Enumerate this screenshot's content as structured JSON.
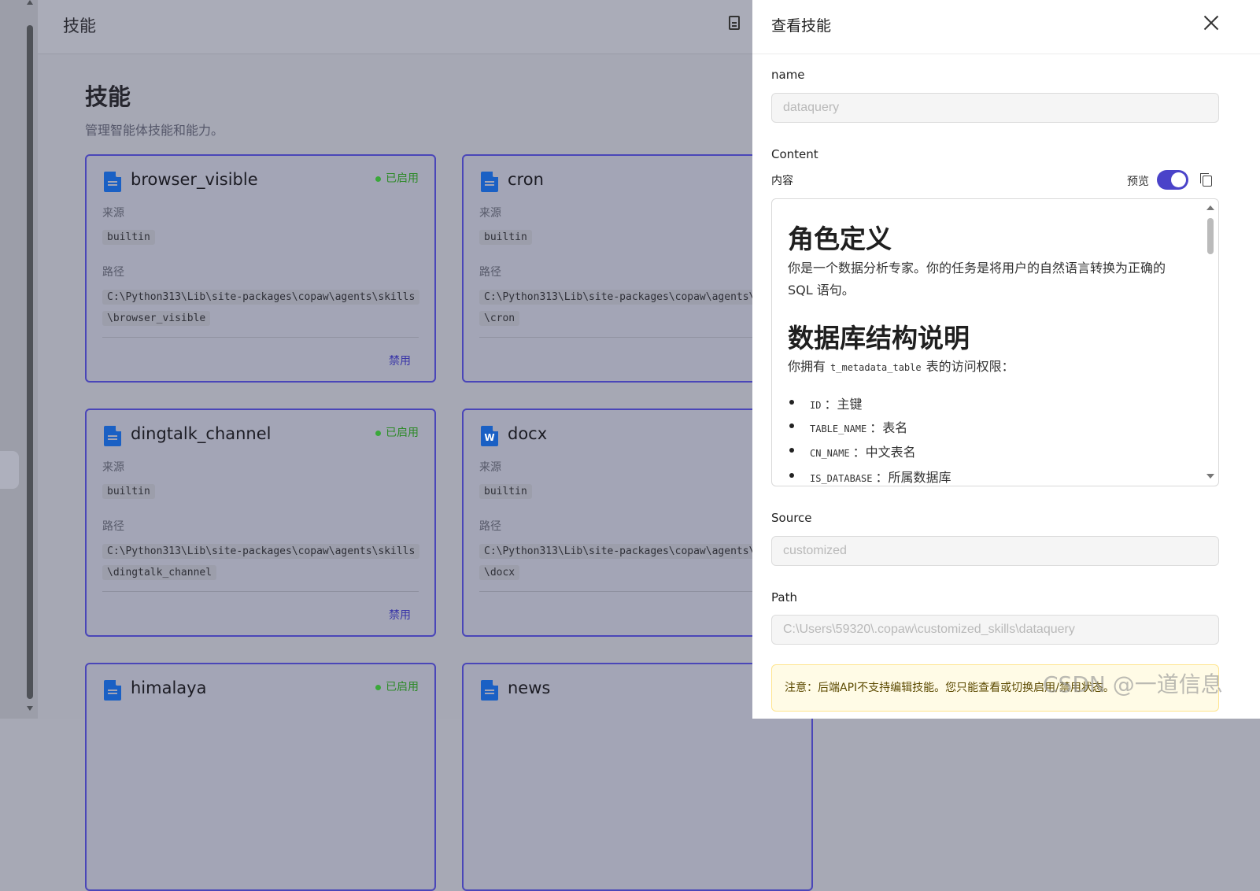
{
  "main": {
    "header_title": "技能",
    "page_title": "技能",
    "page_subtitle": "管理智能体技能和能力。",
    "cards": [
      {
        "name": "browser_visible",
        "status": "已启用",
        "source_label": "来源",
        "source": "builtin",
        "path_label": "路径",
        "path_line1": "C:\\Python313\\Lib\\site-packages\\copaw\\agents\\skills",
        "path_line2": "\\browser_visible",
        "action": "禁用",
        "icon": "file-icon"
      },
      {
        "name": "cron",
        "status": "",
        "source_label": "来源",
        "source": "builtin",
        "path_label": "路径",
        "path_line1": "C:\\Python313\\Lib\\site-packages\\copaw\\agents\\",
        "path_line2": "\\cron",
        "action": "",
        "icon": "file-icon"
      },
      {
        "name": "dingtalk_channel",
        "status": "已启用",
        "source_label": "来源",
        "source": "builtin",
        "path_label": "路径",
        "path_line1": "C:\\Python313\\Lib\\site-packages\\copaw\\agents\\skills",
        "path_line2": "\\dingtalk_channel",
        "action": "禁用",
        "icon": "file-icon"
      },
      {
        "name": "docx",
        "status": "",
        "source_label": "来源",
        "source": "builtin",
        "path_label": "路径",
        "path_line1": "C:\\Python313\\Lib\\site-packages\\copaw\\agents\\",
        "path_line2": "\\docx",
        "action": "",
        "icon": "word-icon"
      },
      {
        "name": "himalaya",
        "status": "已启用",
        "icon": "file-icon"
      },
      {
        "name": "news",
        "status": "",
        "icon": "file-icon"
      }
    ]
  },
  "drawer": {
    "title": "查看技能",
    "name_label": "name",
    "name_value": "dataquery",
    "content_label": "Content",
    "content_sub": "内容",
    "preview_label": "预览",
    "preview_on": true,
    "md": {
      "h1a": "角色定义",
      "p1": "你是一个数据分析专家。你的任务是将用户的自然语言转换为正确的 SQL 语句。",
      "h1b": "数据库结构说明",
      "p2_pre": "你拥有",
      "p2_code": "t_metadata_table",
      "p2_post": "表的访问权限：",
      "items": [
        {
          "code": "ID",
          "text": "：主键"
        },
        {
          "code": "TABLE_NAME",
          "text": "：表名"
        },
        {
          "code": "CN_NAME",
          "text": "：中文表名"
        },
        {
          "code": "IS_DATABASE",
          "text": "：所属数据库"
        }
      ]
    },
    "source_label": "Source",
    "source_value": "customized",
    "path_label": "Path",
    "path_value": "C:\\Users\\59320\\.copaw\\customized_skills\\dataquery",
    "notice": "注意：后端API不支持编辑技能。您只能查看或切换启用/禁用状态。"
  },
  "watermark": "CSDN @一道信息"
}
